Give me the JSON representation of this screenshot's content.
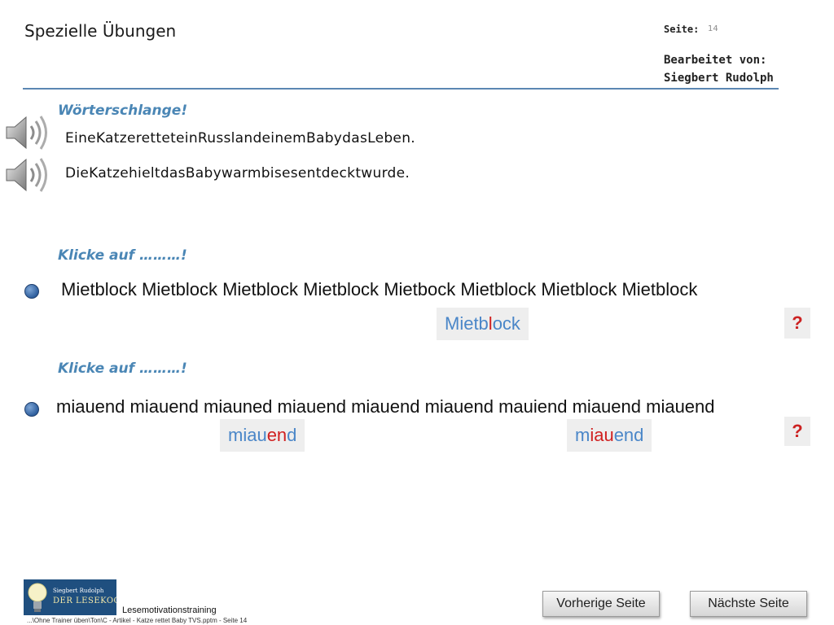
{
  "header": {
    "title": "Spezielle Übungen",
    "seite_label": "Seite:",
    "seite_number": "14",
    "bearbeitet_label": "Bearbeitet von:",
    "author": "Siegbert Rudolph"
  },
  "wortschlange": {
    "heading": "Wörterschlange!",
    "lines": [
      "EineKatzeretteteinRusslandeinemBabydasLeben.",
      "DieKatzehieltdasBabywarmbisesentdecktwurde."
    ]
  },
  "exercise1": {
    "heading": "Klicke auf ………!",
    "words": [
      "Mietblock",
      "Mietblock",
      "Mietblock",
      "Mietblock",
      "Mietbock",
      "Mietblock",
      "Mietblock",
      "Mietblock"
    ],
    "answer": {
      "pre": "Mietb",
      "highlight": "l",
      "post": "ock"
    },
    "question_mark": "?"
  },
  "exercise2": {
    "heading": "Klicke auf ………!",
    "words": [
      "miauend",
      "miauend",
      "miauned",
      "miauend",
      "miauend",
      "miauend",
      "mauiend",
      "miauend",
      "miauend"
    ],
    "answer_a": {
      "pre": "miau",
      "highlight": "en",
      "post": "d"
    },
    "answer_b": {
      "pre": "m",
      "highlight": "iau",
      "post": "end"
    },
    "question_mark": "?"
  },
  "logo": {
    "line1": "Siegbert Rudolph",
    "line2": "DER LESEKOCH"
  },
  "footer": {
    "label": "Lesemotivationstraining",
    "path": "...\\Ohne Trainer üben\\Ton\\C - Artikel - Katze rettet Baby TVS.pptm - Seite 14"
  },
  "nav": {
    "prev": "Vorherige Seite",
    "next": "Nächste Seite"
  },
  "colors": {
    "accent": "#4a86b5",
    "highlight": "#d02020",
    "answer_text": "#4a86c8"
  }
}
